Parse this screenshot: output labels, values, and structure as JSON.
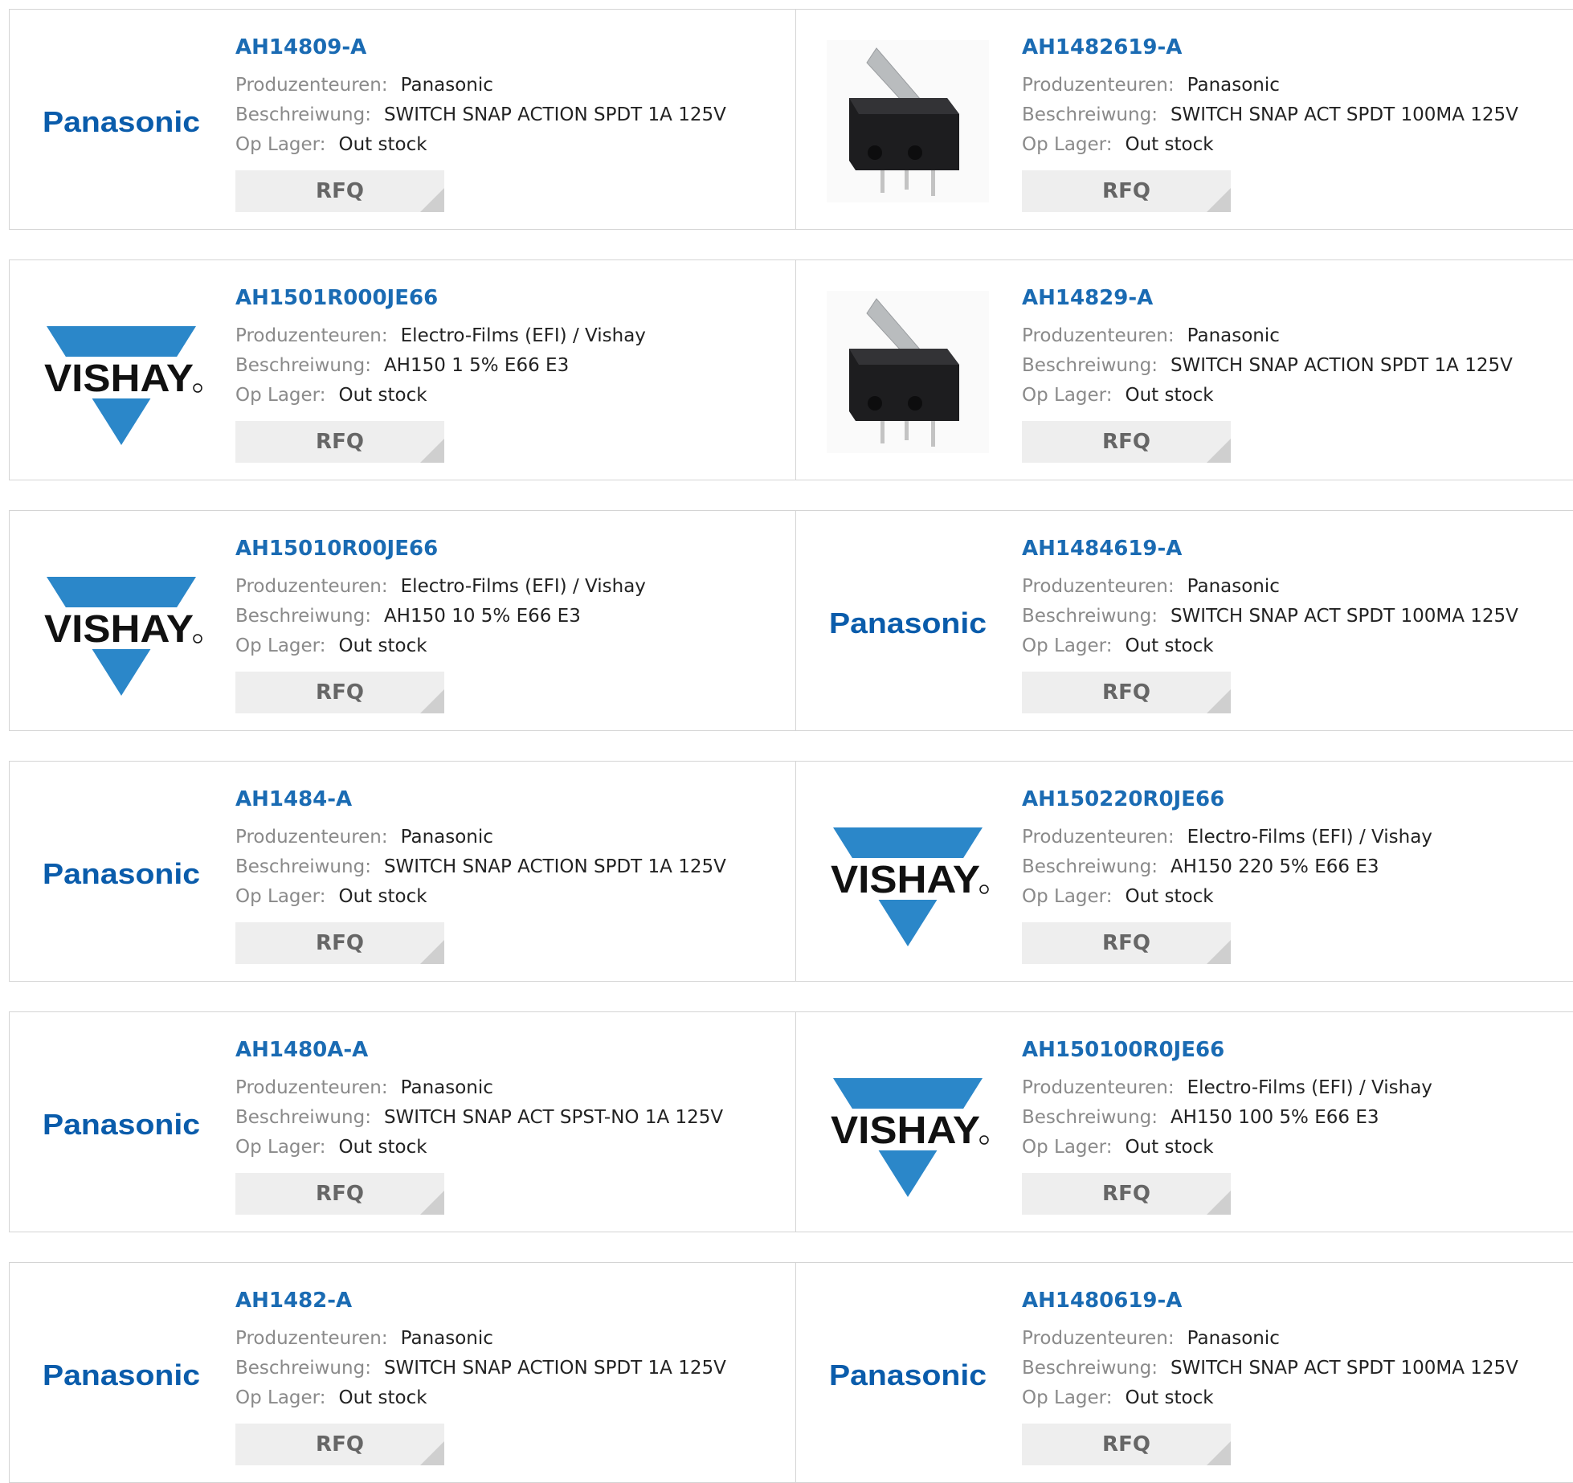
{
  "labels": {
    "manufacturer": "Produzenteuren:",
    "description": "Beschreiwung:",
    "stock": "Op Lager:",
    "rfq": "RFQ"
  },
  "brand_logos": {
    "panasonic": "Panasonic",
    "vishay": "VISHAY"
  },
  "colors": {
    "part_link": "#1a6bb3",
    "panasonic_logo": "#0a5cab",
    "vishay_logo": "#2b87c9",
    "rfq_bg": "#eeeeee"
  },
  "products": [
    {
      "part": "AH14809-A",
      "manufacturer": "Panasonic",
      "description": "SWITCH SNAP ACTION SPDT 1A 125V",
      "stock": "Out stock",
      "image": "panasonic-logo"
    },
    {
      "part": "AH1482619-A",
      "manufacturer": "Panasonic",
      "description": "SWITCH SNAP ACT SPDT 100MA 125V",
      "stock": "Out stock",
      "image": "micro-switch-photo"
    },
    {
      "part": "AH1501R000JE66",
      "manufacturer": "Electro-Films (EFI) / Vishay",
      "description": "AH150 1 5% E66 E3",
      "stock": "Out stock",
      "image": "vishay-logo"
    },
    {
      "part": "AH14829-A",
      "manufacturer": "Panasonic",
      "description": "SWITCH SNAP ACTION SPDT 1A 125V",
      "stock": "Out stock",
      "image": "micro-switch-photo"
    },
    {
      "part": "AH15010R00JE66",
      "manufacturer": "Electro-Films (EFI) / Vishay",
      "description": "AH150 10 5% E66 E3",
      "stock": "Out stock",
      "image": "vishay-logo"
    },
    {
      "part": "AH1484619-A",
      "manufacturer": "Panasonic",
      "description": "SWITCH SNAP ACT SPDT 100MA 125V",
      "stock": "Out stock",
      "image": "panasonic-logo"
    },
    {
      "part": "AH1484-A",
      "manufacturer": "Panasonic",
      "description": "SWITCH SNAP ACTION SPDT 1A 125V",
      "stock": "Out stock",
      "image": "panasonic-logo"
    },
    {
      "part": "AH150220R0JE66",
      "manufacturer": "Electro-Films (EFI) / Vishay",
      "description": "AH150 220 5% E66 E3",
      "stock": "Out stock",
      "image": "vishay-logo"
    },
    {
      "part": "AH1480A-A",
      "manufacturer": "Panasonic",
      "description": "SWITCH SNAP ACT SPST-NO 1A 125V",
      "stock": "Out stock",
      "image": "panasonic-logo"
    },
    {
      "part": "AH150100R0JE66",
      "manufacturer": "Electro-Films (EFI) / Vishay",
      "description": "AH150 100 5% E66 E3",
      "stock": "Out stock",
      "image": "vishay-logo"
    },
    {
      "part": "AH1482-A",
      "manufacturer": "Panasonic",
      "description": "SWITCH SNAP ACTION SPDT 1A 125V",
      "stock": "Out stock",
      "image": "panasonic-logo"
    },
    {
      "part": "AH1480619-A",
      "manufacturer": "Panasonic",
      "description": "SWITCH SNAP ACT SPDT 100MA 125V",
      "stock": "Out stock",
      "image": "panasonic-logo"
    }
  ]
}
